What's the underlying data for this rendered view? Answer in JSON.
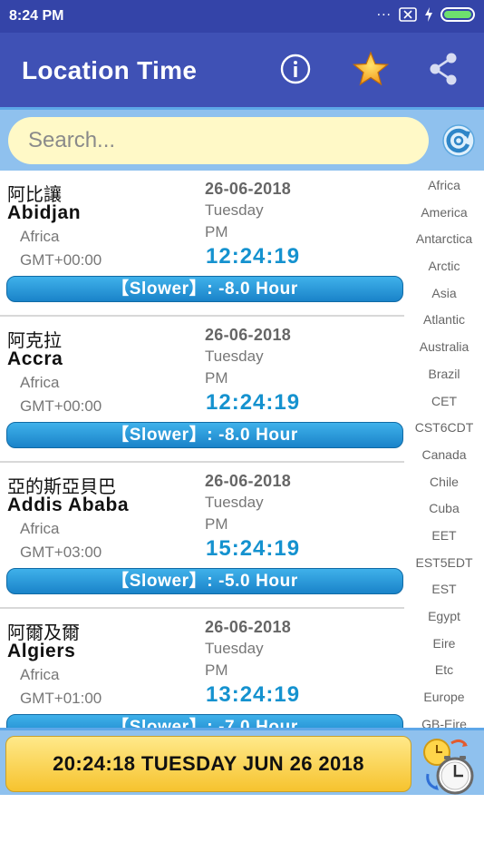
{
  "status_bar": {
    "time": "8:24 PM",
    "dots": "..."
  },
  "app_bar": {
    "title": "Location Time"
  },
  "search": {
    "placeholder": "Search..."
  },
  "items": [
    {
      "native": "阿比讓",
      "city": "Abidjan",
      "region": "Africa",
      "gmt": "GMT+00:00",
      "date": "26-06-2018",
      "day": "Tuesday",
      "ampm": "PM",
      "time": "12:24:19",
      "diff": "【Slower】: -8.0 Hour"
    },
    {
      "native": "阿克拉",
      "city": "Accra",
      "region": "Africa",
      "gmt": "GMT+00:00",
      "date": "26-06-2018",
      "day": "Tuesday",
      "ampm": "PM",
      "time": "12:24:19",
      "diff": "【Slower】: -8.0 Hour"
    },
    {
      "native": "亞的斯亞貝巴",
      "city": "Addis Ababa",
      "region": "Africa",
      "gmt": "GMT+03:00",
      "date": "26-06-2018",
      "day": "Tuesday",
      "ampm": "PM",
      "time": "15:24:19",
      "diff": "【Slower】: -5.0 Hour"
    },
    {
      "native": "阿爾及爾",
      "city": "Algiers",
      "region": "Africa",
      "gmt": "GMT+01:00",
      "date": "26-06-2018",
      "day": "Tuesday",
      "ampm": "PM",
      "time": "13:24:19",
      "diff": "【Slower】: -7.0 Hour"
    }
  ],
  "regions": [
    "Africa",
    "America",
    "Antarctica",
    "Arctic",
    "Asia",
    "Atlantic",
    "Australia",
    "Brazil",
    "CET",
    "CST6CDT",
    "Canada",
    "Chile",
    "Cuba",
    "EET",
    "EST5EDT",
    "EST",
    "Egypt",
    "Eire",
    "Etc",
    "Europe",
    "GB-Eire"
  ],
  "bottom": {
    "clock_text": "20:24:18  TUESDAY  JUN 26 2018"
  },
  "colors": {
    "status_bar": "#3444a8",
    "app_bar": "#3f51b5",
    "accent_blue": "#1592cf",
    "search_bg": "#fff9c7",
    "banner": "#f6c32e"
  }
}
